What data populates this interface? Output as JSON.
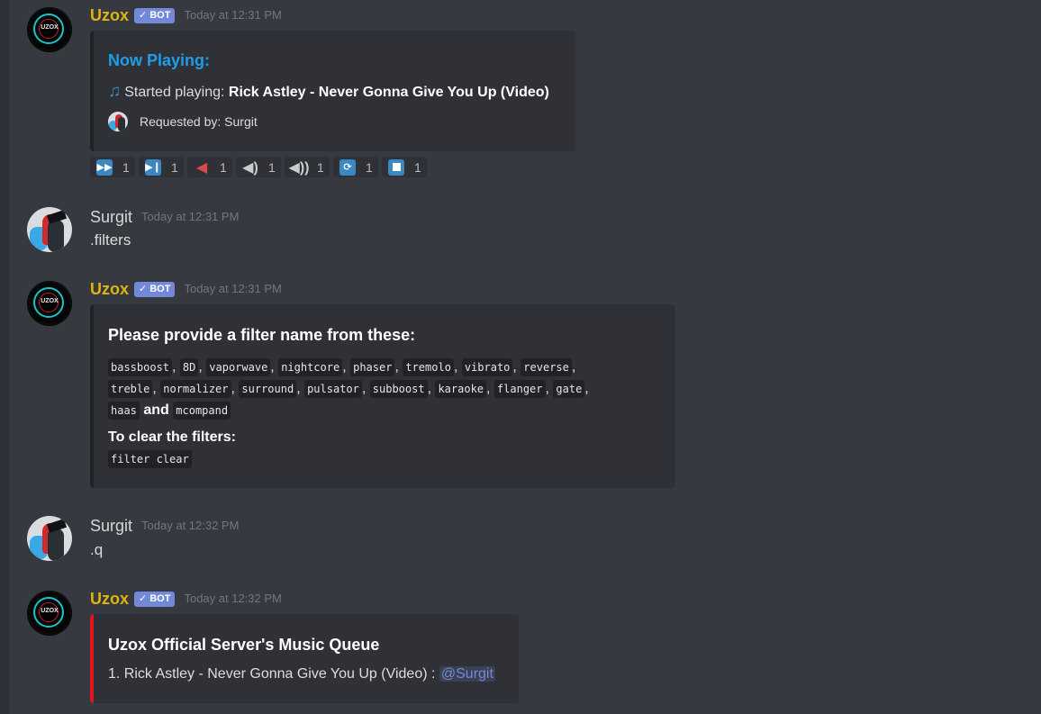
{
  "messages": {
    "m1": {
      "author": "Uzox",
      "bot_tag": "BOT",
      "timestamp": "Today at 12:31 PM",
      "avatar_text": "UZOX",
      "embed": {
        "title": "Now Playing:",
        "started_label": "Started playing:",
        "song": "Rick Astley - Never Gonna Give You Up (Video)",
        "requested_by": "Requested by: Surgit"
      },
      "reactions": [
        {
          "icon": "next-track-icon",
          "glyph": "⏭",
          "count": "1"
        },
        {
          "icon": "play-pause-icon",
          "glyph": "⏯",
          "count": "1"
        },
        {
          "icon": "mute-icon",
          "glyph": "🔇",
          "count": "1"
        },
        {
          "icon": "volume-down-icon",
          "glyph": "🔉",
          "count": "1"
        },
        {
          "icon": "volume-up-icon",
          "glyph": "🔊",
          "count": "1"
        },
        {
          "icon": "repeat-icon",
          "glyph": "🔁",
          "count": "1"
        },
        {
          "icon": "stop-icon",
          "glyph": "⏹",
          "count": "1"
        }
      ]
    },
    "m2": {
      "author": "Surgit",
      "timestamp": "Today at 12:31 PM",
      "text": ".filters"
    },
    "m3": {
      "author": "Uzox",
      "bot_tag": "BOT",
      "timestamp": "Today at 12:31 PM",
      "avatar_text": "UZOX",
      "embed": {
        "title": "Please provide a filter name from these:",
        "filters": [
          "bassboost",
          "8D",
          "vaporwave",
          "nightcore",
          "phaser",
          "tremolo",
          "vibrato",
          "reverse",
          "treble",
          "normalizer",
          "surround",
          "pulsator",
          "subboost",
          "karaoke",
          "flanger",
          "gate",
          "haas",
          "mcompand"
        ],
        "and_word": "and",
        "clear_label": "To clear the filters:",
        "clear_cmd": "filter clear"
      }
    },
    "m4": {
      "author": "Surgit",
      "timestamp": "Today at 12:32 PM",
      "text": ".q"
    },
    "m5": {
      "author": "Uzox",
      "bot_tag": "BOT",
      "timestamp": "Today at 12:32 PM",
      "avatar_text": "UZOX",
      "embed": {
        "title": "Uzox Official Server's Music Queue",
        "queue_item": "1. Rick Astley - Never Gonna Give You Up (Video) :",
        "mention": "@Surgit"
      }
    }
  },
  "colors": {
    "background": "#36393f",
    "embed_bg": "#2f3136",
    "bot_name": "#e0b40f",
    "bot_tag": "#7289da",
    "now_playing_title": "#1d9ee9",
    "queue_embed_border": "#e0151d",
    "reaction_blue": "#3b88c3"
  }
}
